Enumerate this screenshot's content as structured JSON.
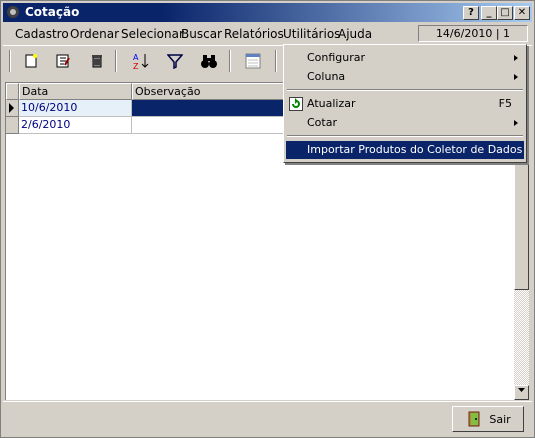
{
  "window": {
    "title": "Cotação"
  },
  "titlebar_buttons": {
    "help": "?",
    "minimize": "_",
    "maximize": "□",
    "close": "✕"
  },
  "menubar": {
    "items": [
      "Cadastro",
      "Ordenar",
      "Selecionar",
      "Buscar",
      "Relatórios",
      "Utilitários",
      "Ajuda"
    ],
    "date_status": "14/6/2010 | 1"
  },
  "toolbar": {
    "icons": [
      "new-icon",
      "edit-icon",
      "delete-icon",
      "sort-icon",
      "filter-icon",
      "find-icon",
      "layout-icon"
    ]
  },
  "grid": {
    "columns": [
      "Data",
      "Observação"
    ],
    "rows": [
      {
        "data": "10/6/2010",
        "observacao": ""
      },
      {
        "data": "2/6/2010",
        "observacao": ""
      }
    ]
  },
  "dropdown": {
    "items": [
      {
        "label": "Configurar",
        "submenu": true
      },
      {
        "label": "Coluna",
        "submenu": true
      },
      {
        "label": "Atualizar",
        "shortcut": "F5"
      },
      {
        "label": "Cotar",
        "submenu": true
      },
      {
        "label": "Importar Produtos do Coletor de Dados",
        "selected": true
      }
    ]
  },
  "footer": {
    "exit_label": "Sair"
  },
  "colors": {
    "title_bar": "#0a246a",
    "selection": "#0a246a",
    "face": "#d4d0c8",
    "cell_text": "#000080"
  }
}
